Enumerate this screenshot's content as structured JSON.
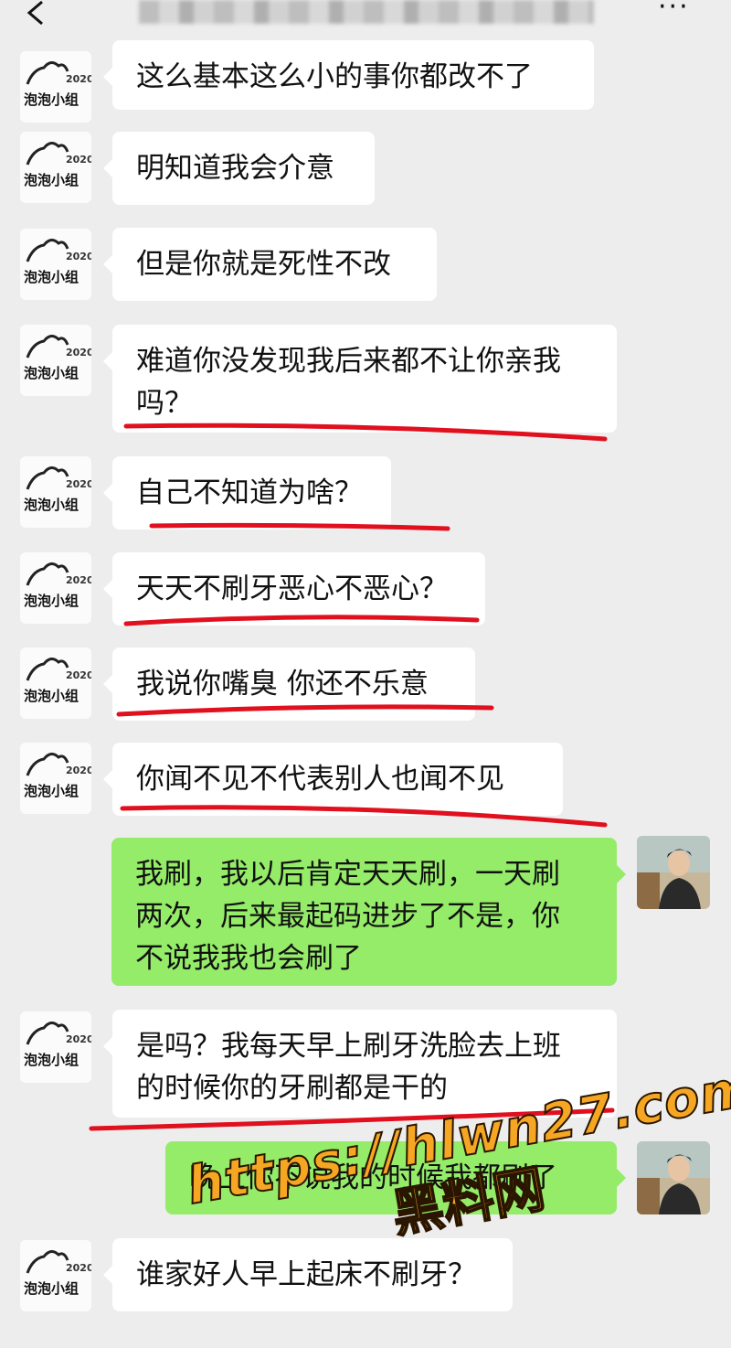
{
  "header": {
    "back_icon": "chevron-left-icon",
    "more_icon": "more-dots-icon",
    "more_label": "···"
  },
  "avatars": {
    "contact_logo_text": "2020",
    "contact_logo_caption": "泡泡小组",
    "self_photo": "avatar-photo"
  },
  "messages": [
    {
      "side": "left",
      "text": "这么基本这么小的事你都改不了"
    },
    {
      "side": "left",
      "text": "明知道我会介意"
    },
    {
      "side": "left",
      "text": "但是你就是死性不改"
    },
    {
      "side": "left",
      "text": "难道你没发现我后来都不让你亲我\n吗？"
    },
    {
      "side": "left",
      "text": "自己不知道为啥？"
    },
    {
      "side": "left",
      "text": "天天不刷牙恶心不恶心？"
    },
    {
      "side": "left",
      "text": "我说你嘴臭 你还不乐意"
    },
    {
      "side": "left",
      "text": "你闻不见不代表别人也闻不见"
    },
    {
      "side": "right",
      "text": "我刷，我以后肯定天天刷，一天刷\n两次，后来最起码进步了不是，你\n不说我我也会刷了"
    },
    {
      "side": "left",
      "text": "是吗？我每天早上刷牙洗脸去上班\n的时候你的牙刷都是干的"
    },
    {
      "side": "right",
      "text": "晚上你不说我的时候我都刷了"
    },
    {
      "side": "left",
      "text": "谁家好人早上起床不刷牙？"
    }
  ],
  "watermark": {
    "url": "https://hlwn27.com",
    "name": "黑料网"
  },
  "colors": {
    "background": "#ededed",
    "left_bubble": "#ffffff",
    "right_bubble": "#95ec69",
    "underline": "#e0101e",
    "watermark": "#f5a623"
  }
}
